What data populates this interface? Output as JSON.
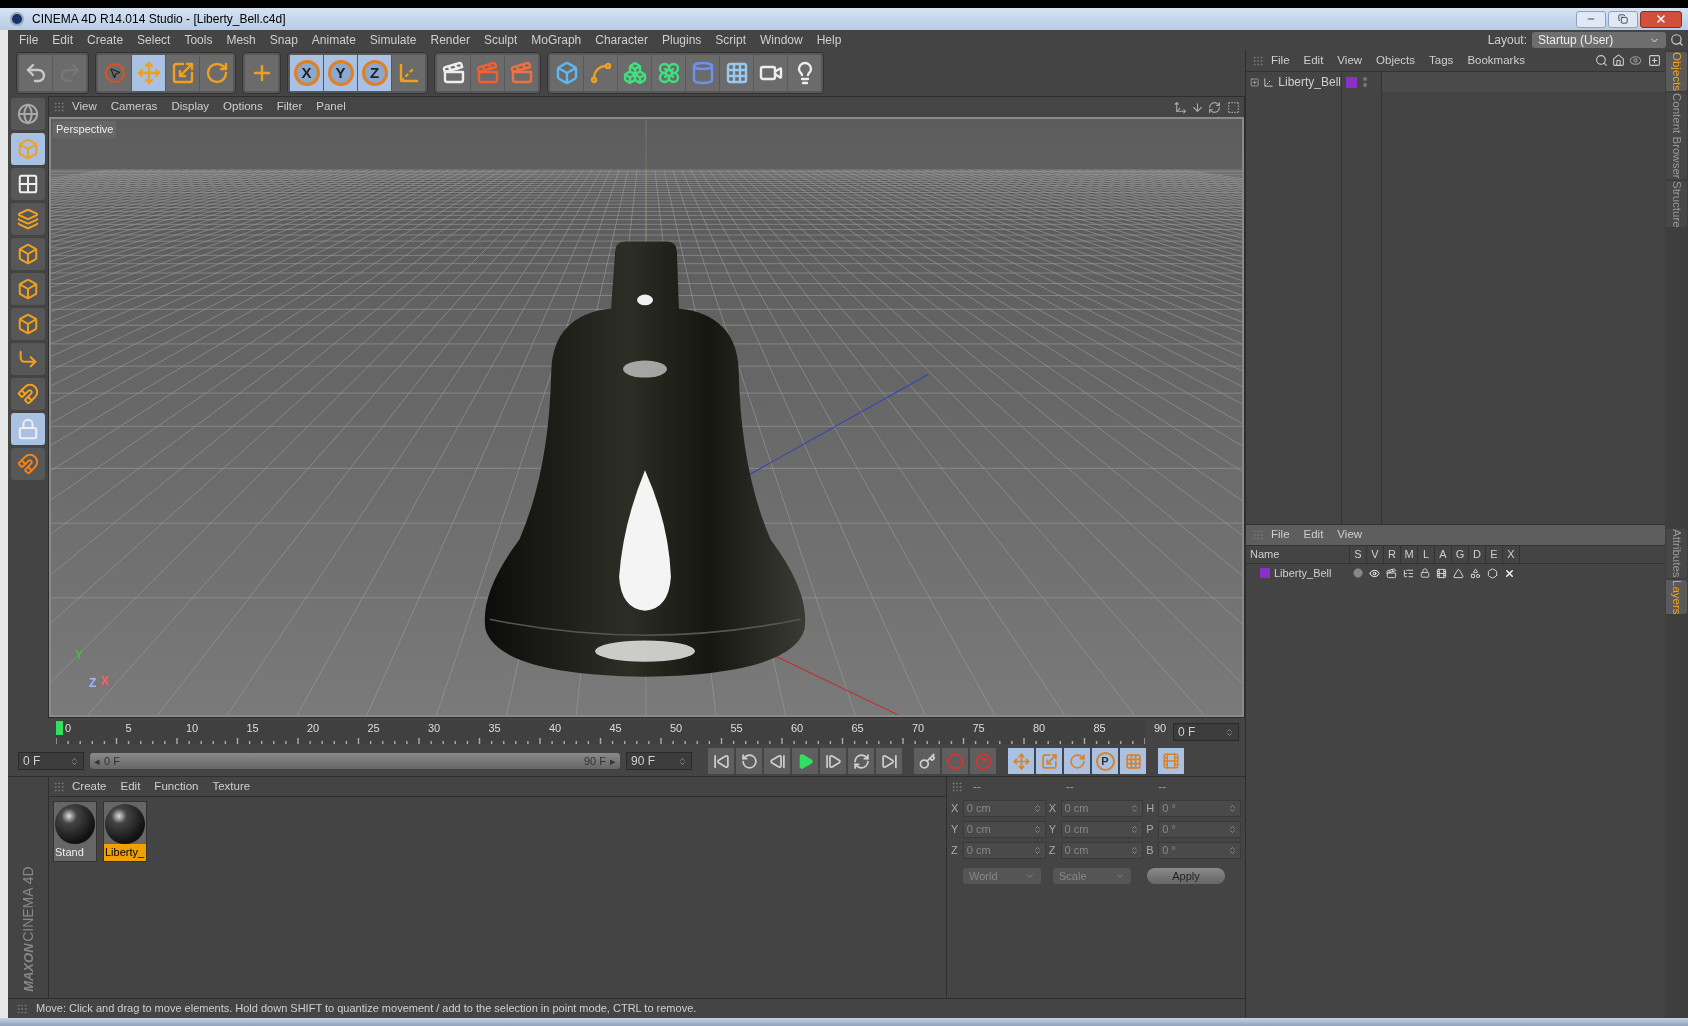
{
  "window": {
    "title": "CINEMA 4D R14.014 Studio - [Liberty_Bell.c4d]"
  },
  "menu": [
    "File",
    "Edit",
    "Create",
    "Select",
    "Tools",
    "Mesh",
    "Snap",
    "Animate",
    "Simulate",
    "Render",
    "Sculpt",
    "MoGraph",
    "Character",
    "Plugins",
    "Script",
    "Window",
    "Help"
  ],
  "layout": {
    "label": "Layout:",
    "value": "Startup (User)"
  },
  "toolbar": [
    {
      "tools": [
        {
          "kind": "undo",
          "selected": false
        },
        {
          "kind": "redo",
          "selected": false
        }
      ]
    },
    {
      "tools": [
        {
          "kind": "select",
          "selected": false
        },
        {
          "kind": "move",
          "selected": true
        },
        {
          "kind": "scale",
          "selected": false
        },
        {
          "kind": "rotate",
          "selected": false
        }
      ]
    },
    {
      "tools": [
        {
          "kind": "add",
          "selected": false
        }
      ]
    },
    {
      "tools": [
        {
          "kind": "axis",
          "label": "X",
          "selected": true
        },
        {
          "kind": "axis",
          "label": "Y",
          "selected": true
        },
        {
          "kind": "axis",
          "label": "Z",
          "selected": true
        },
        {
          "kind": "coords",
          "selected": false
        }
      ]
    },
    {
      "tools": [
        {
          "kind": "render_view",
          "selected": false
        },
        {
          "kind": "render_picture",
          "selected": false
        },
        {
          "kind": "render_settings",
          "selected": false
        }
      ]
    },
    {
      "tools": [
        {
          "kind": "cube",
          "selected": false
        },
        {
          "kind": "spline",
          "selected": false
        },
        {
          "kind": "nurbs",
          "selected": false
        },
        {
          "kind": "array",
          "selected": false
        },
        {
          "kind": "deformer",
          "selected": false
        },
        {
          "kind": "floor",
          "selected": false
        },
        {
          "kind": "camera",
          "selected": false
        },
        {
          "kind": "light",
          "selected": false
        }
      ]
    }
  ],
  "left_tools": [
    {
      "kind": "view",
      "selected": false
    },
    {
      "kind": "model",
      "selected": true
    },
    {
      "kind": "texture",
      "selected": false
    },
    {
      "kind": "workplane",
      "selected": false
    },
    {
      "kind": "points",
      "selected": false
    },
    {
      "kind": "edges",
      "selected": false
    },
    {
      "kind": "polygons",
      "selected": false
    },
    {
      "kind": "axis",
      "selected": false
    },
    {
      "kind": "magnet",
      "selected": false
    },
    {
      "kind": "gridlock",
      "selected": true
    },
    {
      "kind": "snap",
      "selected": false
    }
  ],
  "viewport": {
    "menu": [
      "View",
      "Cameras",
      "Display",
      "Options",
      "Filter",
      "Panel"
    ],
    "camera": "Perspective",
    "gizmo": [
      {
        "label": "Y",
        "color": "#40c040"
      },
      {
        "label": "X",
        "color": "#ff6060"
      },
      {
        "label": "Z",
        "color": "#a0b8ff"
      }
    ]
  },
  "timeline": {
    "labels": [
      "0",
      "5",
      "10",
      "15",
      "20",
      "25",
      "30",
      "35",
      "40",
      "45",
      "50",
      "55",
      "60",
      "65",
      "70",
      "75",
      "80",
      "85",
      "90"
    ],
    "level": 0,
    "frame": "0 F"
  },
  "transport": {
    "start": "0 F",
    "range_start": "0 F",
    "range_end": "90 F",
    "end": "90 F",
    "range_arrows": [
      "◂",
      "▸"
    ],
    "range_slider": {
      "level": 1
    },
    "buttons": [
      {
        "kind": "first",
        "selected": false
      },
      {
        "kind": "prevkey",
        "selected": false
      },
      {
        "kind": "prev",
        "selected": false
      },
      {
        "kind": "play",
        "selected": false
      },
      {
        "kind": "next",
        "selected": false
      },
      {
        "kind": "nextkey",
        "selected": false
      },
      {
        "kind": "last",
        "selected": false
      }
    ],
    "record": [
      {
        "kind": "keyframe",
        "selected": false
      },
      {
        "kind": "record",
        "selected": false
      },
      {
        "kind": "help",
        "selected": false
      }
    ],
    "keys": [
      {
        "kind": "key_move",
        "selected": true
      },
      {
        "kind": "key_scale",
        "selected": true
      },
      {
        "kind": "key_rotate",
        "selected": true
      },
      {
        "kind": "key_param",
        "label": "P",
        "selected": true
      },
      {
        "kind": "key_grid",
        "selected": true
      }
    ],
    "timeline_toggle": {
      "selected": true
    }
  },
  "materials": {
    "menu": [
      "Create",
      "Edit",
      "Function",
      "Texture"
    ],
    "items": [
      {
        "name": "Stand",
        "selected": false
      },
      {
        "name": "Liberty_",
        "selected": true
      }
    ]
  },
  "coordinates": {
    "headers": [
      "--",
      "--",
      "--"
    ],
    "rows": [
      {
        "cells": [
          {
            "axis": "X",
            "value": "0 cm"
          },
          {
            "axis": "X",
            "value": "0 cm"
          },
          {
            "axis": "H",
            "value": "0 °"
          }
        ]
      },
      {
        "cells": [
          {
            "axis": "Y",
            "value": "0 cm"
          },
          {
            "axis": "Y",
            "value": "0 cm"
          },
          {
            "axis": "P",
            "value": "0 °"
          }
        ]
      },
      {
        "cells": [
          {
            "axis": "Z",
            "value": "0 cm"
          },
          {
            "axis": "Z",
            "value": "0 cm"
          },
          {
            "axis": "B",
            "value": "0 °"
          }
        ]
      }
    ],
    "modes": [
      "World",
      "Scale"
    ],
    "apply": "Apply"
  },
  "objects": {
    "menu": [
      "File",
      "Edit",
      "View",
      "Objects",
      "Tags",
      "Bookmarks"
    ],
    "items": [
      {
        "name": "Liberty_Bell",
        "color": "#8a30c8"
      }
    ]
  },
  "layers": {
    "menu": [
      "File",
      "Edit",
      "View"
    ],
    "columns": [
      "Name",
      "S",
      "V",
      "R",
      "M",
      "L",
      "A",
      "G",
      "D",
      "E",
      "X"
    ],
    "rows": [
      {
        "name": "Liberty_Bell",
        "color": "#8a30c8"
      }
    ]
  },
  "side_tabs": {
    "upper": [
      {
        "label": "Objects",
        "selected": true
      },
      {
        "label": "Content Browser",
        "selected": false
      },
      {
        "label": "Structure",
        "selected": false
      }
    ],
    "lower": [
      {
        "label": "Attributes",
        "selected": false
      },
      {
        "label": "Layers",
        "selected": true
      }
    ]
  },
  "logo": {
    "brand": "MAXON",
    "product": "CINEMA 4D"
  },
  "status_bar": "Move: Click and drag to move elements. Hold down SHIFT to quantize movement / add to the selection in point mode, CTRL to remove."
}
